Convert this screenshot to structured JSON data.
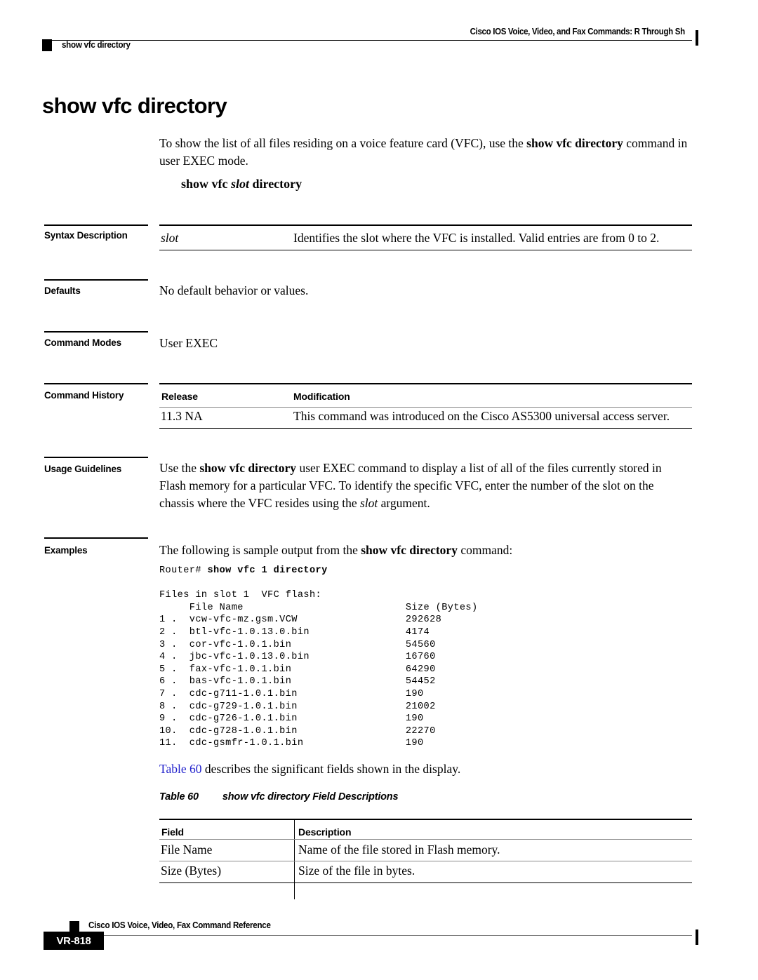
{
  "header": {
    "left_text": "show vfc directory",
    "right_text": "Cisco IOS Voice, Video, and Fax Commands: R Through Sh"
  },
  "page": {
    "title": "show vfc directory",
    "intro_pre": "To show the list of all files residing on a voice feature card (VFC), use the ",
    "intro_bold": "show vfc directory",
    "intro_post": " command in user EXEC mode.",
    "syntax_pre": "show vfc ",
    "syntax_arg": "slot",
    "syntax_post": " directory"
  },
  "sections": {
    "syntax_description": {
      "label": "Syntax Description",
      "rows": [
        {
          "term": "slot",
          "description": "Identifies the slot where the VFC is installed. Valid entries are from 0 to 2."
        }
      ]
    },
    "defaults": {
      "label": "Defaults",
      "text": "No default behavior or values."
    },
    "command_modes": {
      "label": "Command Modes",
      "text": "User EXEC"
    },
    "command_history": {
      "label": "Command History",
      "columns": [
        "Release",
        "Modification"
      ],
      "rows": [
        {
          "release": "11.3 NA",
          "modification": "This command was introduced on the Cisco AS5300 universal access server."
        }
      ]
    },
    "usage_guidelines": {
      "label": "Usage Guidelines",
      "line1_pre": "Use the ",
      "line1_bold": "show vfc directory",
      "line1_post": " user EXEC command to display a list of all of the files currently stored in",
      "line2": "Flash memory for a particular VFC. To identify the specific VFC, enter the number of the slot on the",
      "line3_pre": "chassis where the VFC resides using the ",
      "line3_arg": "slot",
      "line3_post": " argument."
    },
    "examples": {
      "label": "Examples",
      "intro_pre": "The following is sample output from the ",
      "intro_bold": "show vfc directory",
      "intro_post": " command:"
    }
  },
  "code_output": {
    "prompt": "Router# ",
    "command": "show vfc 1 directory",
    "lines": [
      "",
      "Files in slot 1  VFC flash:",
      "     File Name                           Size (Bytes)",
      "1 .  vcw-vfc-mz.gsm.VCW                  292628",
      "2 .  btl-vfc-1.0.13.0.bin                4174",
      "3 .  cor-vfc-1.0.1.bin                   54560",
      "4 .  jbc-vfc-1.0.13.0.bin                16760",
      "5 .  fax-vfc-1.0.1.bin                   64290",
      "6 .  bas-vfc-1.0.1.bin                   54452",
      "7 .  cdc-g711-1.0.1.bin                  190",
      "8 .  cdc-g729-1.0.1.bin                  21002",
      "9 .  cdc-g726-1.0.1.bin                  190",
      "10.  cdc-g728-1.0.1.bin                  22270",
      "11.  cdc-gsmfr-1.0.1.bin                 190"
    ]
  },
  "table60": {
    "xref_link": "Table 60",
    "xref_rest": " describes the significant fields shown in the display.",
    "caption_number": "Table 60",
    "caption_title": "show vfc directory Field Descriptions",
    "columns": [
      "Field",
      "Description"
    ],
    "rows": [
      {
        "field": "File Name",
        "description": "Name of the file stored in Flash memory."
      },
      {
        "field": "Size (Bytes)",
        "description": "Size of the file in bytes."
      }
    ]
  },
  "footer": {
    "title": "Cisco IOS Voice, Video, Fax Command Reference",
    "page_number": "VR-818"
  },
  "colors": {
    "xref_blue": "#2222cc",
    "rule_black": "#000000",
    "rule_gray": "#8a8a8a"
  }
}
